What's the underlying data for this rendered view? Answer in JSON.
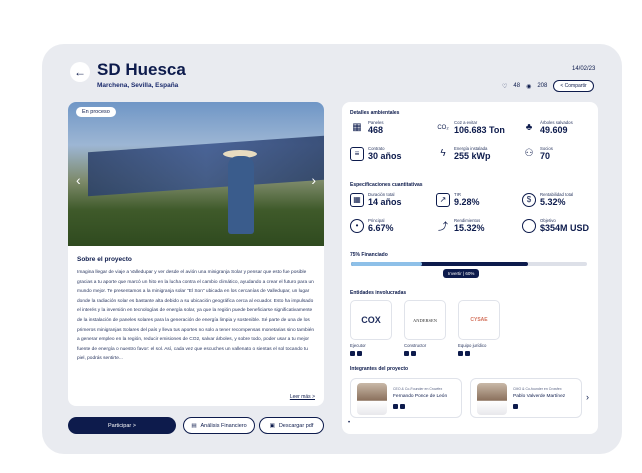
{
  "header": {
    "back_icon": "arrow-left-icon",
    "title": "SD Huesca",
    "location": "Marchena, Sevilla, España",
    "date": "14/02/23",
    "likes": "48",
    "views": "208",
    "share_label": "Compartir"
  },
  "left": {
    "badge": "En proceso",
    "about_title": "Sobre el proyecto",
    "about_text": "Imagina llegar de viaje a Valledupar y ver desde el avión una minigranja Solar y pensar que esto fue posible gracias a tu aporte que marcó un hito en la lucha contra el cambio climático, ayudando a crear el futuro para un mundo mejor. Te presentamos a la minigranja solar \"El Son\" ubicada en los cercanías de Valledupar, un lugar donde la radiación solar es bastante alta debido a su ubicación geográfica cerca al ecuador. Esto ha impulsado el interés y la inversión en tecnologías de energía solar, ya que la región puede beneficiarse significativamente de la instalación de paneles solares para la generación de energía limpia y sostenible. Sé parte de una de los primeros minigranjas Solares del país y lleva tus aportes no solo a tener recompensas monetarias sino también a generar empleo en la región, reducir emisiones de CO2, salvar árboles, y sobre todo, poder usar a tu mejor fuente de energía o nuestro favor: el sol. Así, cada vez que escuches un vallenato o sientas el sol tocando tu piel, podrás sentirte...",
    "read_more": "Leer más >"
  },
  "actions": {
    "participate": "Participar >",
    "financial": "Análisis Financiero",
    "download": "Descargar pdf"
  },
  "env": {
    "title": "Detalles ambientales",
    "items": [
      {
        "icon": "solar-panel-icon",
        "label": "Paneles",
        "value": "468"
      },
      {
        "icon": "co2-icon",
        "label": "Co2 a evitar",
        "value": "106.683 Ton"
      },
      {
        "icon": "trees-icon",
        "label": "Árboles salvados",
        "value": "49.609"
      },
      {
        "icon": "contract-icon",
        "label": "Contrato",
        "value": "30 años"
      },
      {
        "icon": "lightning-icon",
        "label": "Energía instalada",
        "value": "255 kWp"
      },
      {
        "icon": "partners-icon",
        "label": "Socios",
        "value": "70"
      }
    ]
  },
  "quant": {
    "title": "Especificaciones cuantitativas",
    "items": [
      {
        "icon": "calendar-icon",
        "label": "Duración total",
        "value": "14 años"
      },
      {
        "icon": "trend-icon",
        "label": "TIR",
        "value": "9.28%"
      },
      {
        "icon": "dollar-icon",
        "label": "Rentabilidad total",
        "value": "5.32%"
      },
      {
        "icon": "target-icon",
        "label": "Principal",
        "value": "6.67%"
      },
      {
        "icon": "growth-icon",
        "label": "Rendimientos",
        "value": "15.32%"
      },
      {
        "icon": "goal-icon",
        "label": "Objetivo",
        "value": "$354M USD"
      }
    ]
  },
  "funding": {
    "title": "75% Financiado",
    "funded_fraction": 0.75,
    "invested_fraction": 0.6,
    "tooltip": "Invertir | 60%"
  },
  "entities": {
    "title": "Entidades involucradas",
    "items": [
      {
        "name": "COX",
        "role": "Ejecutor"
      },
      {
        "name": "ANDERSEN",
        "role": "Constructor"
      },
      {
        "name": "CYSAE",
        "role": "Equipo jurídico"
      }
    ]
  },
  "members": {
    "title": "Integrantes del proyecto",
    "items": [
      {
        "role": "CEO & Co-Founder en Crowfex",
        "name": "Fernando Ponce de León"
      },
      {
        "role": "CMO & Co-founder en Crowfex",
        "name": "Pablo Valverde Martínez"
      }
    ]
  }
}
